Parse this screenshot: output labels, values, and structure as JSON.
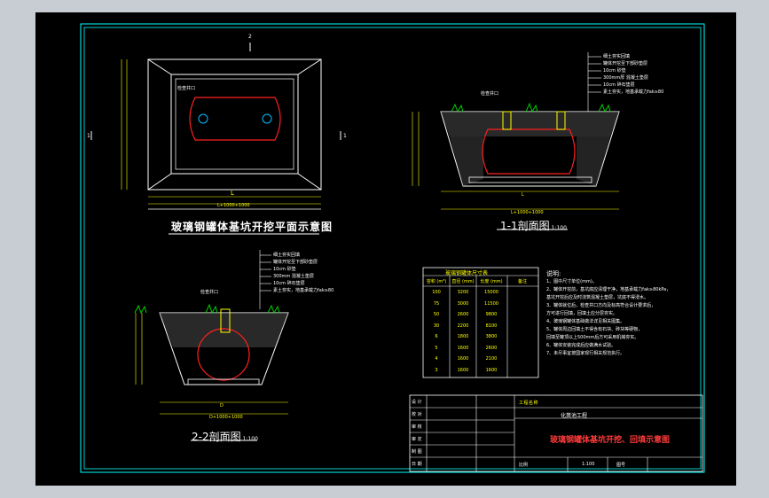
{
  "titles": {
    "plan": "玻璃钢罐体基坑开挖平面示意图",
    "section_1": "1-1剖面图",
    "section_1_scale": "1:100",
    "section_2": "2-2剖面图",
    "section_2_scale": "1:100"
  },
  "plan_labels": {
    "marker_top": "2",
    "marker_left": "1",
    "marker_right": "1",
    "inlet": "检查井口",
    "L": "L",
    "L_total": "L+1000+1000"
  },
  "section1": {
    "callouts": [
      "细土夯实回填",
      "罐体开挖至下部砂垫层",
      "10cm 砂垫",
      "300mm厚 混凝土垫层",
      "10cm 碎石垫层",
      "素土夯实，地基承载力fak≥80"
    ],
    "inlet": "检查井口",
    "dims": [
      "D",
      "H",
      "L1",
      "L",
      "L+1000+1000"
    ]
  },
  "section2": {
    "callouts": [
      "细土夯实回填",
      "罐体开挖至下部砂垫层",
      "10cm 砂垫",
      "300mm 混凝土垫层",
      "10cm 碎石垫层",
      "素土夯实，地基承载力fak≥80"
    ],
    "inlet": "检查井口",
    "dims": [
      "D",
      "D+1000+1000"
    ]
  },
  "size_table": {
    "title": "玻璃钢罐体尺寸表",
    "headers": [
      "容积 (m³)",
      "直径 (mm)",
      "长度 (mm)",
      "备注"
    ],
    "rows": [
      [
        "100",
        "3200",
        "15000",
        ""
      ],
      [
        "75",
        "3000",
        "11500",
        ""
      ],
      [
        "50",
        "2600",
        "9800",
        ""
      ],
      [
        "30",
        "2200",
        "8100",
        ""
      ],
      [
        "6",
        "1800",
        "3800",
        ""
      ],
      [
        "5",
        "1600",
        "2600",
        ""
      ],
      [
        "4",
        "1600",
        "2100",
        ""
      ],
      [
        "3",
        "1600",
        "1600",
        ""
      ]
    ]
  },
  "notes": {
    "heading": "说明:",
    "lines": [
      "1、图中尺寸单位(mm)。",
      "2、罐体开挖前，基坑底应清理干净，地基承载力fak≥80kPa，",
      "   基坑开挖后应及时浇筑混凝土垫层，坑底不得浸水。",
      "3、罐体就位后，检查井口方向及标高符合设计要求后，",
      "   方可进行回填，回填土应分层夯实。",
      "4、玻璃钢罐体基础做法详见相关图集。",
      "5、罐体周边回填土不得含有石块、砖块等硬物，",
      "   回填至罐顶以上500mm后方可采用机械夯实。",
      "6、罐体安装完成后应做满水试验。",
      "7、未尽事宜按国家现行相关规范执行。"
    ]
  },
  "title_block": {
    "project": "工程名称",
    "project_value": "化粪池工程",
    "drawing_title": "玻璃钢罐体基坑开挖、回填示意图",
    "scale_label": "比例",
    "scale_value": "1:100",
    "sheet_label": "图号",
    "sheet_value": "",
    "left_labels": [
      "设 计",
      "校 对",
      "审 核",
      "审 定",
      "制 图",
      "日 期"
    ]
  },
  "colors": {
    "frame": "#00ffff",
    "cad_bg": "#000000",
    "yellow": "#ffff00",
    "red": "#ff3b3b",
    "green": "#00d000"
  }
}
